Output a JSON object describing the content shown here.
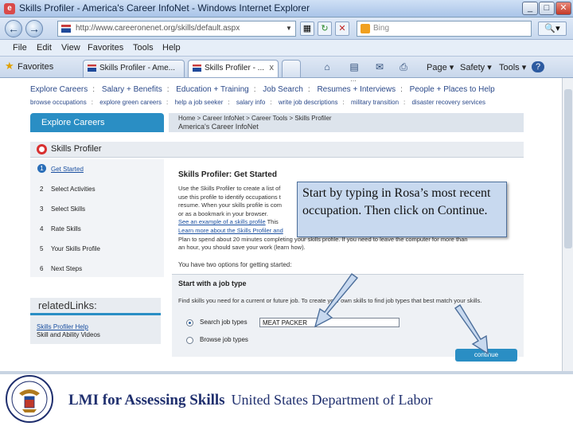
{
  "window": {
    "title": "Skills Profiler - America's Career InfoNet - Windows Internet Explorer",
    "minimize": "_",
    "maximize": "□",
    "close": "✕"
  },
  "address": {
    "url": "http://www.careeronenet.org/skills/default.aspx",
    "search_placeholder": "Bing"
  },
  "menu": [
    "File",
    "Edit",
    "View",
    "Favorites",
    "Tools",
    "Help"
  ],
  "tabs": {
    "favorites": "Favorites",
    "items": [
      {
        "label": "Skills Profiler - Ame..."
      },
      {
        "label": "Skills Profiler - ..."
      }
    ],
    "close": "x"
  },
  "commandbar": {
    "page": "Page",
    "safety": "Safety",
    "tools": "Tools",
    "help": "?"
  },
  "site": {
    "top_cut": "…",
    "main_nav": [
      "Explore Careers",
      "Salary + Benefits",
      "Education + Training",
      "Job Search",
      "Resumes + Interviews",
      "People + Places to Help"
    ],
    "sub_nav": [
      "browse occupations",
      "explore green careers",
      "help a job seeker",
      "salary info",
      "write job descriptions",
      "military transition",
      "disaster recovery services"
    ],
    "explore_tab": "Explore Careers",
    "crumb": "Home > Career InfoNet > Career Tools > Skills Profiler",
    "crumb_site": "America's Career InfoNet",
    "profiler_title": "Skills Profiler",
    "steps": [
      {
        "num": "1",
        "label": "Get Started"
      },
      {
        "num": "2",
        "label": "Select Activities"
      },
      {
        "num": "3",
        "label": "Select Skills"
      },
      {
        "num": "4",
        "label": "Rate Skills"
      },
      {
        "num": "5",
        "label": "Your Skills Profile"
      },
      {
        "num": "6",
        "label": "Next Steps"
      }
    ],
    "related_title": "relatedLinks:",
    "related_link1": "Skills Profiler Help",
    "related_link2": "Skill and Ability Videos",
    "main_title": "Skills Profiler: Get Started",
    "body_lines": [
      "Use the Skills Profiler to create a list of",
      "use this profile to identify occupations t",
      "resume. When your skills profile is com",
      "or as a bookmark in your browser."
    ],
    "body_link1": "See an example of a skills profile",
    "body_line5": "This",
    "body_link2": "Learn more about the Skills Profiler and",
    "body_line7": "Plan to spend about 20 minutes completing your skills profile. If you need to leave the computer for more than",
    "body_line8": "an hour, you should save your work (learn how).",
    "options_text": "You have two options for getting started:",
    "start_title": "Start with a job type",
    "start_desc": "Find skills you need for a current or future job. To create your own skills to find job types that best match your skills.",
    "radio1": "Search job types",
    "job_value": "MEAT PACKER",
    "radio2": "Browse job types",
    "continue": "continue"
  },
  "callout": {
    "text": "Start by typing in Rosa’s most recent occupation.  Then click on Continue."
  },
  "footer": {
    "bold": "LMI for Assessing Skills",
    "regular": "United States Department of Labor"
  }
}
